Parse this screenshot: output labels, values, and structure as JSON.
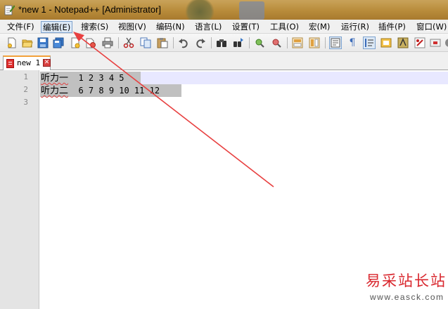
{
  "window": {
    "title": "*new 1 - Notepad++ [Administrator]"
  },
  "menu": {
    "items": [
      {
        "label": "文件(F)"
      },
      {
        "label": "编辑(E)"
      },
      {
        "label": "搜索(S)"
      },
      {
        "label": "视图(V)"
      },
      {
        "label": "编码(N)"
      },
      {
        "label": "语言(L)"
      },
      {
        "label": "设置(T)"
      },
      {
        "label": "工具(O)"
      },
      {
        "label": "宏(M)"
      },
      {
        "label": "运行(R)"
      },
      {
        "label": "插件(P)"
      },
      {
        "label": "窗口(W)"
      }
    ],
    "active_item": "编辑(E)"
  },
  "toolbar": {
    "icons": [
      "new-file-icon",
      "open-file-icon",
      "save-icon",
      "save-all-icon",
      "close-icon",
      "close-all-icon",
      "print-icon",
      "cut-icon",
      "copy-icon",
      "paste-icon",
      "undo-icon",
      "redo-icon",
      "find-icon",
      "replace-icon",
      "zoom-in-icon",
      "zoom-out-icon",
      "sync-vertical-icon",
      "sync-horizontal-icon",
      "word-wrap-icon",
      "show-all-chars-icon",
      "indent-guide-icon",
      "doc-map-icon",
      "function-list-icon",
      "record-macro-icon",
      "stop-macro-icon",
      "play-macro-icon"
    ]
  },
  "tabs": [
    {
      "label": "new 1",
      "modified": true
    }
  ],
  "editor": {
    "line_numbers": [
      "1",
      "2",
      "3"
    ],
    "lines": [
      {
        "cjk": "听力一",
        "rest": "  1 2 3 4 5"
      },
      {
        "cjk": "听力二",
        "rest": "  6 7 8 9 10 11 12"
      },
      {
        "cjk": "",
        "rest": ""
      }
    ]
  },
  "watermark": {
    "site_name": "易采站长站",
    "url": "www.easck.com"
  },
  "colors": {
    "annotation_arrow": "#e84040",
    "tab_accent": "#f2a03a",
    "selection": "#c0c0c0",
    "current_line": "#e8e8ff",
    "watermark": "#d9272e"
  }
}
